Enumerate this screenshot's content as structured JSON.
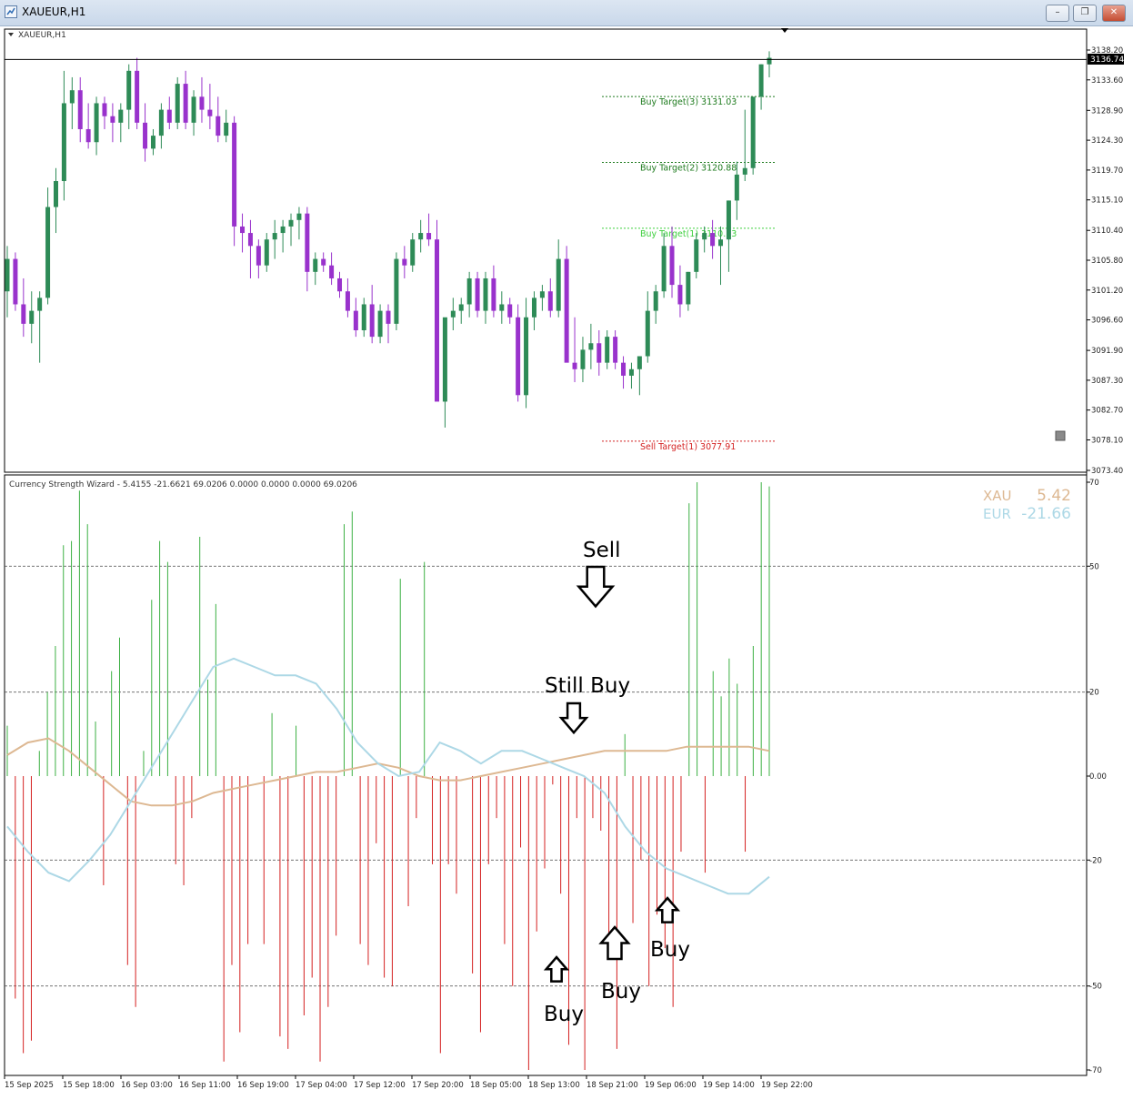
{
  "window": {
    "title": "XAUEUR,H1"
  },
  "window_controls": {
    "minimize": "–",
    "restore": "❐",
    "close": "✕"
  },
  "main_panel": {
    "symbol_label": "XAUEUR,H1",
    "current_price": "3136.74",
    "price_ticks": [
      "3138.20",
      "3133.60",
      "3128.90",
      "3124.30",
      "3119.70",
      "3115.10",
      "3110.40",
      "3105.80",
      "3101.20",
      "3096.60",
      "3091.90",
      "3087.30",
      "3082.70",
      "3078.10",
      "3073.40"
    ],
    "levels": [
      {
        "label": "Buy Target(3) 3131.03",
        "price": 3131.03,
        "color": "#1e7b1e"
      },
      {
        "label": "Buy Target(2) 3120.88",
        "price": 3120.88,
        "color": "#1e7b1e"
      },
      {
        "label": "Buy Target(1) 3110.73",
        "price": 3110.73,
        "color": "#3ccf3c"
      },
      {
        "label": "Sell Target(1) 3077.91",
        "price": 3077.91,
        "color": "#d42020"
      }
    ],
    "colors": {
      "bull": "#2e8b57",
      "bear": "#9932cc"
    }
  },
  "indicator_panel": {
    "header": "Currency Strength Wizard - 5.4155 -21.6621 69.0206 0.0000 0.0000 0.0000 69.0206",
    "ticks": [
      "70",
      "50",
      "20",
      "0.00",
      "-20",
      "-50",
      "-70"
    ],
    "legend": [
      {
        "name": "XAU",
        "value": "5.42",
        "color": "#ddb892"
      },
      {
        "name": "EUR",
        "value": "-21.66",
        "color": "#add8e6"
      }
    ],
    "colors": {
      "pos_hist": "#3cb043",
      "neg_hist": "#d42020"
    }
  },
  "annotations": [
    {
      "text": "Sell",
      "arrow": "down"
    },
    {
      "text": "Still Buy",
      "arrow": "down"
    },
    {
      "text": "Buy",
      "arrow": "up"
    },
    {
      "text": "Buy",
      "arrow": "up"
    },
    {
      "text": "Buy",
      "arrow": "up"
    }
  ],
  "time_axis": [
    "15 Sep 2025",
    "15 Sep 18:00",
    "16 Sep 03:00",
    "16 Sep 11:00",
    "16 Sep 19:00",
    "17 Sep 04:00",
    "17 Sep 12:00",
    "17 Sep 20:00",
    "18 Sep 05:00",
    "18 Sep 13:00",
    "18 Sep 21:00",
    "19 Sep 06:00",
    "19 Sep 14:00",
    "19 Sep 22:00"
  ],
  "chart_data": [
    {
      "type": "candlestick",
      "ylim": [
        3073.4,
        3138.2
      ],
      "ohlc": [
        [
          3101,
          3108,
          3097,
          3106
        ],
        [
          3106,
          3107,
          3098,
          3099
        ],
        [
          3099,
          3103,
          3094,
          3096
        ],
        [
          3096,
          3101,
          3093,
          3098
        ],
        [
          3098,
          3101,
          3090,
          3100
        ],
        [
          3100,
          3117,
          3099,
          3114
        ],
        [
          3114,
          3120,
          3110,
          3118
        ],
        [
          3118,
          3135,
          3115,
          3130
        ],
        [
          3130,
          3134,
          3126,
          3132
        ],
        [
          3132,
          3134,
          3124,
          3126
        ],
        [
          3126,
          3130,
          3123,
          3124
        ],
        [
          3124,
          3131,
          3122,
          3130
        ],
        [
          3130,
          3131,
          3126,
          3128
        ],
        [
          3128,
          3130,
          3124,
          3127
        ],
        [
          3127,
          3130,
          3124,
          3129
        ],
        [
          3129,
          3136,
          3126,
          3135
        ],
        [
          3135,
          3137,
          3126,
          3127
        ],
        [
          3127,
          3130,
          3121,
          3123
        ],
        [
          3123,
          3126,
          3122,
          3125
        ],
        [
          3125,
          3130,
          3123,
          3129
        ],
        [
          3129,
          3131,
          3126,
          3127
        ],
        [
          3127,
          3134,
          3126,
          3133
        ],
        [
          3133,
          3135,
          3126,
          3127
        ],
        [
          3127,
          3132,
          3125,
          3131
        ],
        [
          3131,
          3134,
          3127,
          3129
        ],
        [
          3129,
          3133,
          3126,
          3128
        ],
        [
          3128,
          3131,
          3124,
          3125
        ],
        [
          3125,
          3129,
          3124,
          3127
        ],
        [
          3127,
          3128,
          3108,
          3111
        ],
        [
          3111,
          3113,
          3107,
          3110
        ],
        [
          3110,
          3112,
          3103,
          3108
        ],
        [
          3108,
          3109,
          3103,
          3105
        ],
        [
          3105,
          3110,
          3104,
          3109
        ],
        [
          3109,
          3112,
          3106,
          3110
        ],
        [
          3110,
          3112,
          3107,
          3111
        ],
        [
          3111,
          3113,
          3108,
          3112
        ],
        [
          3112,
          3114,
          3109,
          3113
        ],
        [
          3113,
          3114,
          3101,
          3104
        ],
        [
          3104,
          3107,
          3102,
          3106
        ],
        [
          3106,
          3107,
          3104,
          3105
        ],
        [
          3105,
          3107,
          3102,
          3103
        ],
        [
          3103,
          3104,
          3100,
          3101
        ],
        [
          3101,
          3103,
          3097,
          3098
        ],
        [
          3098,
          3100,
          3094,
          3095
        ],
        [
          3095,
          3100,
          3094,
          3099
        ],
        [
          3099,
          3102,
          3093,
          3094
        ],
        [
          3094,
          3099,
          3093,
          3098
        ],
        [
          3098,
          3099,
          3093,
          3096
        ],
        [
          3096,
          3107,
          3095,
          3106
        ],
        [
          3106,
          3108,
          3103,
          3105
        ],
        [
          3105,
          3110,
          3104,
          3109
        ],
        [
          3109,
          3112,
          3107,
          3110
        ],
        [
          3110,
          3113,
          3108,
          3109
        ],
        [
          3109,
          3112,
          3100,
          3084
        ],
        [
          3084,
          3090,
          3080,
          3097
        ],
        [
          3097,
          3100,
          3095,
          3098
        ],
        [
          3098,
          3100,
          3096,
          3099
        ],
        [
          3099,
          3104,
          3097,
          3103
        ],
        [
          3103,
          3104,
          3097,
          3098
        ],
        [
          3098,
          3104,
          3096,
          3103
        ],
        [
          3103,
          3105,
          3097,
          3098
        ],
        [
          3098,
          3101,
          3096,
          3099
        ],
        [
          3099,
          3100,
          3096,
          3097
        ],
        [
          3097,
          3099,
          3084,
          3085
        ],
        [
          3085,
          3100,
          3083,
          3097
        ],
        [
          3097,
          3101,
          3095,
          3100
        ],
        [
          3100,
          3102,
          3098,
          3101
        ],
        [
          3101,
          3103,
          3097,
          3098
        ],
        [
          3098,
          3109,
          3097,
          3106
        ],
        [
          3106,
          3108,
          3094,
          3090
        ],
        [
          3090,
          3097,
          3087,
          3089
        ],
        [
          3089,
          3094,
          3087,
          3092
        ],
        [
          3092,
          3096,
          3089,
          3093
        ],
        [
          3093,
          3095,
          3088,
          3090
        ],
        [
          3090,
          3095,
          3089,
          3094
        ],
        [
          3094,
          3095,
          3089,
          3090
        ],
        [
          3090,
          3091,
          3086,
          3088
        ],
        [
          3088,
          3090,
          3086,
          3089
        ],
        [
          3089,
          3091,
          3085,
          3091
        ],
        [
          3091,
          3101,
          3090,
          3098
        ],
        [
          3098,
          3102,
          3096,
          3101
        ],
        [
          3101,
          3110,
          3100,
          3108
        ],
        [
          3108,
          3111,
          3100,
          3102
        ],
        [
          3102,
          3105,
          3097,
          3099
        ],
        [
          3099,
          3104,
          3098,
          3104
        ],
        [
          3104,
          3110,
          3103,
          3109
        ],
        [
          3109,
          3111,
          3107,
          3110
        ],
        [
          3110,
          3112,
          3106,
          3108
        ],
        [
          3108,
          3111,
          3102,
          3109
        ],
        [
          3109,
          3115,
          3104,
          3115
        ],
        [
          3115,
          3121,
          3112,
          3119
        ],
        [
          3119,
          3129,
          3118,
          3120
        ],
        [
          3120,
          3126,
          3119,
          3131
        ],
        [
          3131,
          3136,
          3129,
          3136
        ],
        [
          3136,
          3138,
          3134,
          3137
        ]
      ]
    },
    {
      "type": "bar",
      "ylim": [
        -70,
        70
      ],
      "histogram": [
        12,
        -53,
        -66,
        -63,
        6,
        20,
        31,
        55,
        56,
        68,
        60,
        13,
        -26,
        25,
        33,
        -45,
        -55,
        6,
        42,
        56,
        51,
        -21,
        -26,
        -10,
        57,
        23,
        41,
        -68,
        -45,
        -61,
        -40,
        0,
        -40,
        15,
        -62,
        -65,
        12,
        -57,
        -48,
        -68,
        -55,
        -38,
        60,
        63,
        -40,
        -45,
        -16,
        -48,
        -50,
        47,
        -31,
        -10,
        51,
        -21,
        -66,
        -21,
        -28,
        0,
        -47,
        -61,
        -21,
        -10,
        -40,
        -50,
        -17,
        -70,
        -37,
        -22,
        -2,
        -28,
        -64,
        -10,
        -70,
        -10,
        -13,
        -43,
        -65,
        10,
        -35,
        -20,
        -50,
        -33,
        -41,
        -55,
        -18,
        65,
        72,
        -23,
        25,
        19,
        28,
        22,
        -18,
        31,
        72,
        69
      ],
      "series": [
        {
          "name": "XAU",
          "values": [
            5,
            8,
            9,
            6,
            2,
            -2,
            -6,
            -7,
            -7,
            -6,
            -4,
            -3,
            -2,
            -1,
            0,
            1,
            1,
            2,
            3,
            2,
            0,
            -1,
            -1,
            0,
            1,
            2,
            3,
            4,
            5,
            6,
            6,
            6,
            6,
            7,
            7,
            7,
            7,
            6
          ]
        },
        {
          "name": "EUR",
          "values": [
            -12,
            -18,
            -23,
            -25,
            -20,
            -14,
            -6,
            2,
            10,
            18,
            26,
            28,
            26,
            24,
            24,
            22,
            16,
            8,
            3,
            0,
            1,
            8,
            6,
            3,
            6,
            6,
            4,
            2,
            0,
            -4,
            -12,
            -18,
            -22,
            -24,
            -26,
            -28,
            -28,
            -24
          ]
        }
      ]
    }
  ]
}
